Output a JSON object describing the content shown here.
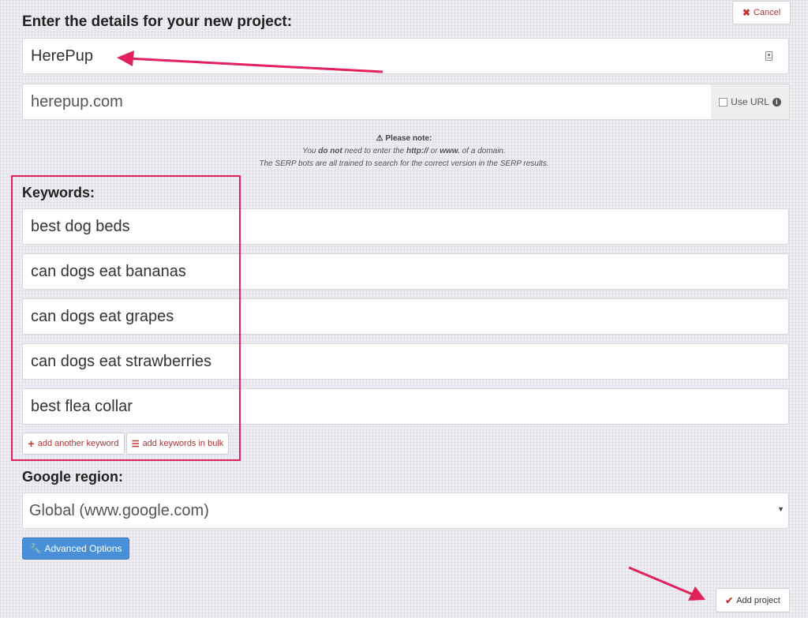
{
  "header": {
    "title": "Enter the details for your new project:",
    "cancel_label": "Cancel"
  },
  "project": {
    "name_value": "HerePup",
    "domain_value": "herepup.com",
    "use_url_label": "Use URL"
  },
  "note": {
    "title": "Please note:",
    "line1_pre": "You ",
    "line1_bold": "do not",
    "line1_mid": " need to enter the ",
    "line1_http": "http://",
    "line1_or": " or ",
    "line1_www": "www.",
    "line1_post": " of a domain.",
    "line2": "The SERP bots are all trained to search for the correct version in the SERP results."
  },
  "keywords": {
    "label": "Keywords:",
    "items": [
      "best dog beds",
      "can dogs eat bananas",
      "can dogs eat grapes",
      "can dogs eat strawberries",
      "best flea collar"
    ],
    "add_another_label": "add another keyword",
    "add_bulk_label": "add keywords in bulk"
  },
  "region": {
    "label": "Google region:",
    "selected": "Global (www.google.com)"
  },
  "advanced_options_label": "Advanced Options",
  "add_project_label": "Add project",
  "colors": {
    "annotation": "#e0215c",
    "primary_button": "#4a90d9",
    "danger": "#c0392b"
  }
}
